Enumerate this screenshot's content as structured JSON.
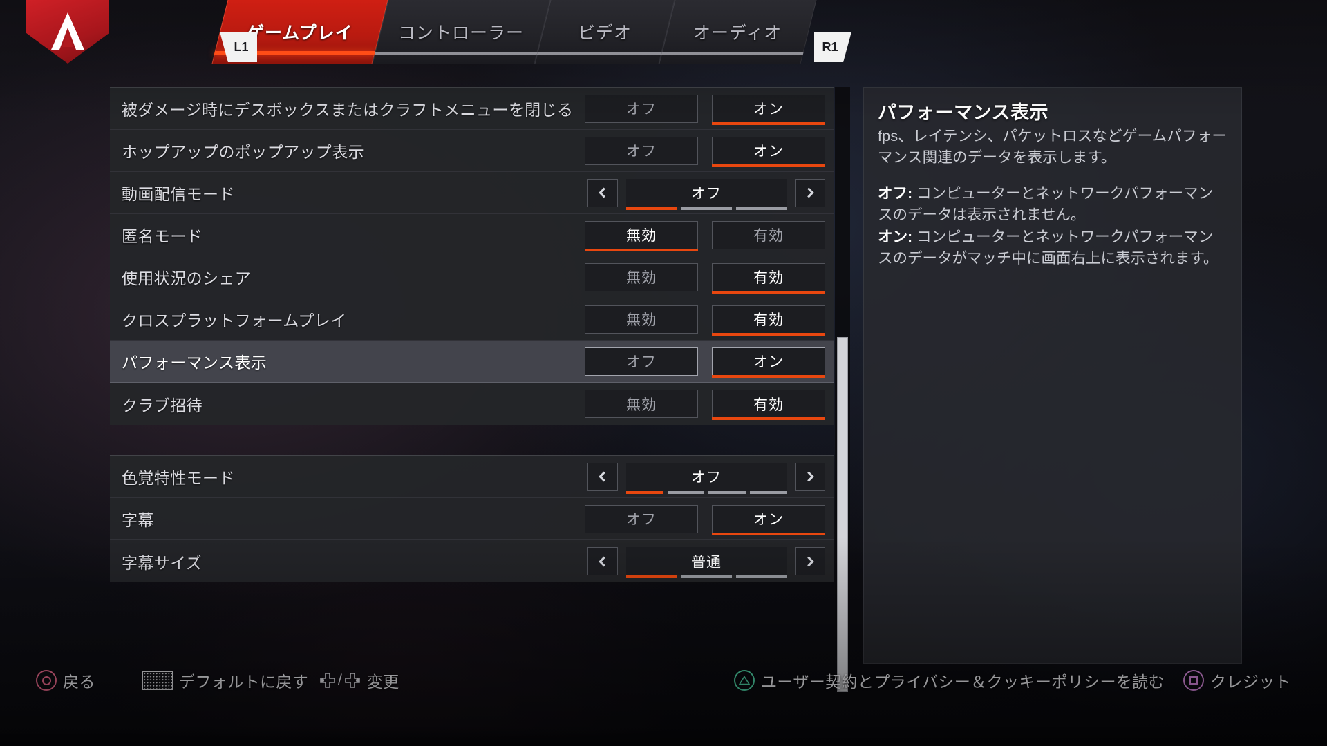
{
  "header": {
    "logo_icon": "apex-legends-logo",
    "bumper_left": "L1",
    "bumper_right": "R1",
    "tabs": [
      {
        "label": "ゲームプレイ",
        "active": true
      },
      {
        "label": "コントローラー",
        "active": false
      },
      {
        "label": "ビデオ",
        "active": false
      },
      {
        "label": "オーディオ",
        "active": false
      }
    ]
  },
  "settings": {
    "group1": [
      {
        "label": "被ダメージ時にデスボックスまたはクラフトメニューを閉じる",
        "type": "toggle",
        "options": [
          "オフ",
          "オン"
        ],
        "selected": "オン",
        "highlighted": false
      },
      {
        "label": "ホップアップのポップアップ表示",
        "type": "toggle",
        "options": [
          "オフ",
          "オン"
        ],
        "selected": "オン",
        "highlighted": false
      },
      {
        "label": "動画配信モード",
        "type": "stepper",
        "value": "オフ",
        "segments": 3,
        "active_segment": 1,
        "prev_icon": "chevron-left-icon",
        "next_icon": "chevron-right-icon",
        "highlighted": false
      },
      {
        "label": "匿名モード",
        "type": "toggle",
        "options": [
          "無効",
          "有効"
        ],
        "selected": "無効",
        "highlighted": false
      },
      {
        "label": "使用状況のシェア",
        "type": "toggle",
        "options": [
          "無効",
          "有効"
        ],
        "selected": "有効",
        "highlighted": false
      },
      {
        "label": "クロスプラットフォームプレイ",
        "type": "toggle",
        "options": [
          "無効",
          "有効"
        ],
        "selected": "有効",
        "highlighted": false
      },
      {
        "label": "パフォーマンス表示",
        "type": "toggle",
        "options": [
          "オフ",
          "オン"
        ],
        "selected": "オン",
        "highlighted": true
      },
      {
        "label": "クラブ招待",
        "type": "toggle",
        "options": [
          "無効",
          "有効"
        ],
        "selected": "有効",
        "highlighted": false
      }
    ],
    "group2": [
      {
        "label": "色覚特性モード",
        "type": "stepper",
        "value": "オフ",
        "segments": 4,
        "active_segment": 1,
        "prev_icon": "chevron-left-icon",
        "next_icon": "chevron-right-icon",
        "highlighted": false
      },
      {
        "label": "字幕",
        "type": "toggle",
        "options": [
          "オフ",
          "オン"
        ],
        "selected": "オン",
        "highlighted": false
      },
      {
        "label": "字幕サイズ",
        "type": "stepper",
        "value": "普通",
        "segments": 3,
        "active_segment": 1,
        "prev_icon": "chevron-left-icon",
        "next_icon": "chevron-right-icon",
        "highlighted": false
      }
    ]
  },
  "info_panel": {
    "title": "パフォーマンス表示",
    "description": "fps、レイテンシ、パケットロスなどゲームパフォーマンス関連のデータを表示します。",
    "options": [
      {
        "key": "オフ: ",
        "text": "コンピューターとネットワークパフォーマンスのデータは表示されません。"
      },
      {
        "key": "オン: ",
        "text": "コンピューターとネットワークパフォーマンスのデータがマッチ中に画面右上に表示されます。"
      }
    ]
  },
  "bottom_bar": {
    "back": {
      "icon": "ps-circle-button-icon",
      "label": "戻る"
    },
    "defaults": {
      "icon": "ps-touchpad-icon",
      "label": "デフォルトに戻す"
    },
    "change": {
      "icon": "dpad-left-right-icon",
      "separator": "/",
      "label": "変更"
    },
    "agreement": {
      "icon": "ps-triangle-button-icon",
      "label": "ユーザー契約とプライバシー＆クッキーポリシーを読む"
    },
    "credits": {
      "icon": "ps-square-button-icon",
      "label": "クレジット"
    }
  },
  "colors": {
    "accent_orange": "#e8470f",
    "tab_red": "#cf1f13",
    "logo_red": "#cf2026",
    "panel_bg": "#282930",
    "row_bg": "#28292e",
    "row_selected": "#4c4e56"
  }
}
